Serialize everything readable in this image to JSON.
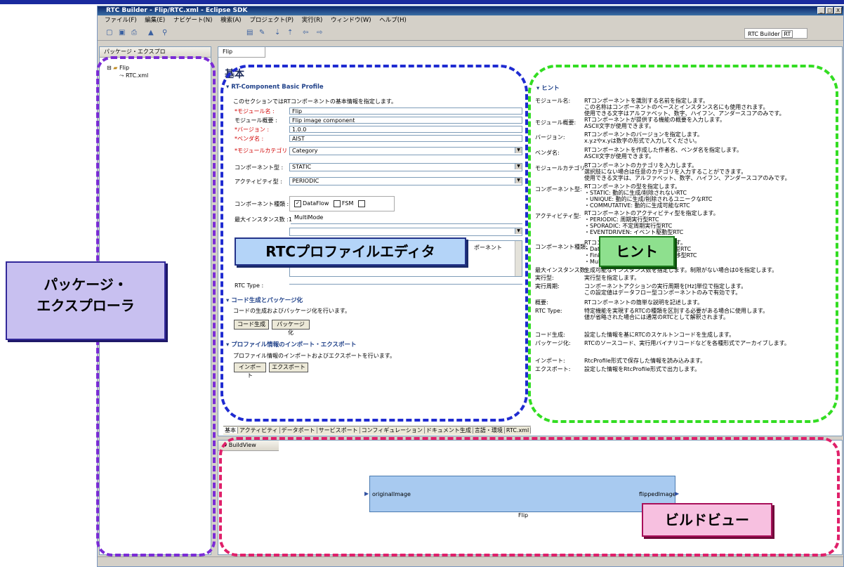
{
  "window": {
    "title": "RTC Builder - Flip/RTC.xml - Eclipse SDK",
    "controls": [
      "_",
      "□",
      "X"
    ]
  },
  "menu": [
    "ファイル(F)",
    "編集(E)",
    "ナビゲート(N)",
    "検索(A)",
    "プロジェクト(P)",
    "実行(R)",
    "ウィンドウ(W)",
    "ヘルプ(H)"
  ],
  "perspective": {
    "label": "RTC Builder",
    "badge": "RT"
  },
  "package_explorer": {
    "tab": "パッケージ・エクスプロ",
    "items": [
      {
        "label": "Flip",
        "icon": "folder-icon"
      },
      {
        "label": "RTC.xml",
        "icon": "rtc-file-icon"
      }
    ]
  },
  "editor": {
    "tab": "Flip",
    "title": "基本",
    "section1": {
      "title": "RT-Component Basic Profile",
      "desc": "このセクションではRTコンポーネントの基本情報を指定します。",
      "fields": [
        {
          "label": "*モジュール名 :",
          "value": "Flip",
          "required": true
        },
        {
          "label": "モジュール概要 :",
          "value": "Flip image component",
          "required": false
        },
        {
          "label": "*バージョン :",
          "value": "1.0.0",
          "required": true
        },
        {
          "label": "*ベンダ名 :",
          "value": "AIST",
          "required": true
        },
        {
          "label": "*モジュールカテゴリ :",
          "value": "Category",
          "required": true
        }
      ],
      "component_type": {
        "label": "コンポーネント型 :",
        "value": "STATIC"
      },
      "activity_type": {
        "label": "アクティビティ型 :",
        "value": "PERIODIC"
      },
      "component_kind": {
        "label": "コンポーネント種類 :",
        "options": [
          {
            "label": "DataFlow",
            "checked": true
          },
          {
            "label": "FSM",
            "checked": false
          },
          {
            "label": "MultiMode",
            "checked": false
          }
        ]
      },
      "max_instances": {
        "label": "最大インスタンス数 :",
        "value": "1"
      },
      "list_text": "ポーネント",
      "rtc_type": {
        "label": "RTC Type :",
        "value": ""
      }
    },
    "section2": {
      "title": "コード生成とパッケージ化",
      "desc": "コードの生成およびパッケージ化を行います。",
      "buttons": [
        "コード生成",
        "パッケージ化"
      ]
    },
    "section3": {
      "title": "プロファイル情報のインポート・エクスポート",
      "desc": "プロファイル情報のインポートおよびエクスポートを行います。",
      "buttons": [
        "インポート",
        "エクスポート"
      ]
    },
    "bottom_tabs": [
      "基本",
      "アクティビティ",
      "データポート",
      "サービスポート",
      "コンフィギュレーション",
      "ドキュメント生成",
      "言語・環境",
      "RTC.xml"
    ]
  },
  "hint": {
    "title": "ヒント",
    "rows": [
      {
        "label": "モジュール名:",
        "text": [
          "RTコンポーネントを識別する名前を指定します。",
          "この名称はコンポーネントのベースとインスタンス名にも使用されます。",
          "使用できる文字はアルファベット、数字、ハイフン、アンダースコアのみです。"
        ]
      },
      {
        "label": "モジュール概要:",
        "text": [
          "RTコンポーネントが提供する機能の概要を入力します。",
          "ASCII文字が使用できます。"
        ]
      },
      {
        "label": "バージョン:",
        "text": [
          "RTコンポーネントのバージョンを指定します。",
          "x.y.zやx.yは数字の形式で入力してください。"
        ]
      },
      {
        "label": "ベンダ名:",
        "text": [
          "RTコンポーネントを作成した作者名、ベンダ名を指定します。",
          "ASCII文字が使用できます。"
        ]
      },
      {
        "label": "モジュールカテゴリ:",
        "text": [
          "RTコンポーネントのカテゴリを入力します。",
          "選択肢にない場合は任意のカテゴリを入力することができます。",
          "使用できる文字は、アルファベット、数字、ハイフン、アンダースコアのみです。"
        ]
      },
      {
        "label": "コンポーネント型:",
        "text": [
          "RTコンポーネントの型を指定します。",
          "・STATIC: 動的に生成/削除されないRTC",
          "・UNIQUE: 動的に生成/削除されるユニークなRTC",
          "・COMMUTATIVE: 動的に生成可能なRTC"
        ]
      },
      {
        "label": "アクティビティ型:",
        "text": [
          "RTコンポーネントのアクティビティ型を指定します。",
          "・PERIODIC: 周期実行型RTC",
          "・SPORADIC: 不定周期実行型RTC",
          "・EVENTDRIVEN: イベント駆動型RTC"
        ]
      },
      {
        "label": "コンポーネント種類:",
        "text": [
          "RTコンポーネントの種類を指定します。",
          "・DataFlowComponent: 周期実行型RTC",
          "・FiniteStateMachine: 有限状態遷移型RTC",
          "・MultiMode: マルチモード型RTC"
        ]
      },
      {
        "label": "最大インスタンス数:",
        "text": [
          "生成可能なインスタンス数を指定します。制限がない場合は0を指定します。"
        ]
      },
      {
        "label": "実行型:",
        "text": [
          "実行型を指定します。"
        ]
      },
      {
        "label": "実行周期:",
        "text": [
          "コンポーネントアクションの実行周期を[Hz]単位で指定します。",
          "この設定値はデータフロー型コンポーネントのみで有効です。"
        ]
      },
      {
        "label": "概要:",
        "text": [
          "RTコンポーネントの簡単な説明を記述します。"
        ]
      },
      {
        "label": "RTC Type:",
        "text": [
          "特定機能を実現するRTCの種類を区別する必要がある場合に使用します。",
          "値が省略された場合には通常のRTCとして解釈されます。"
        ]
      },
      {
        "label": "コード生成:",
        "text": [
          "設定した情報を基にRTCのスケルトンコードを生成します。"
        ]
      },
      {
        "label": "パッケージ化:",
        "text": [
          "RTCのソースコード、実行用バイナリコードなどを各種形式でアーカイブします。"
        ]
      },
      {
        "label": "インポート:",
        "text": [
          "RtcProfile形式で保存した情報を読み込みます。"
        ]
      },
      {
        "label": "エクスポート:",
        "text": [
          "設定した情報をRtcProfile形式で出力します。"
        ]
      }
    ]
  },
  "buildview": {
    "tab": "BuildView",
    "component": "Flip",
    "in_port": "originalImage",
    "out_port": "flippedImage"
  },
  "callouts": {
    "editor": "RTCプロファイルエディタ",
    "hint": "ヒント",
    "explorer": "パッケージ・\nエクスプローラ",
    "build": "ビルドビュー"
  },
  "colors": {
    "title_bar": "#0a246a",
    "callout_blue": "#b4d4f8",
    "callout_green": "#8ee08e",
    "callout_purple": "#c8c0f0",
    "callout_pink": "#f7c0e0",
    "dash_blue": "#1f2bd1",
    "dash_green": "#33dd22",
    "dash_purple": "#7b2bd6",
    "dash_pink": "#e0206a"
  }
}
